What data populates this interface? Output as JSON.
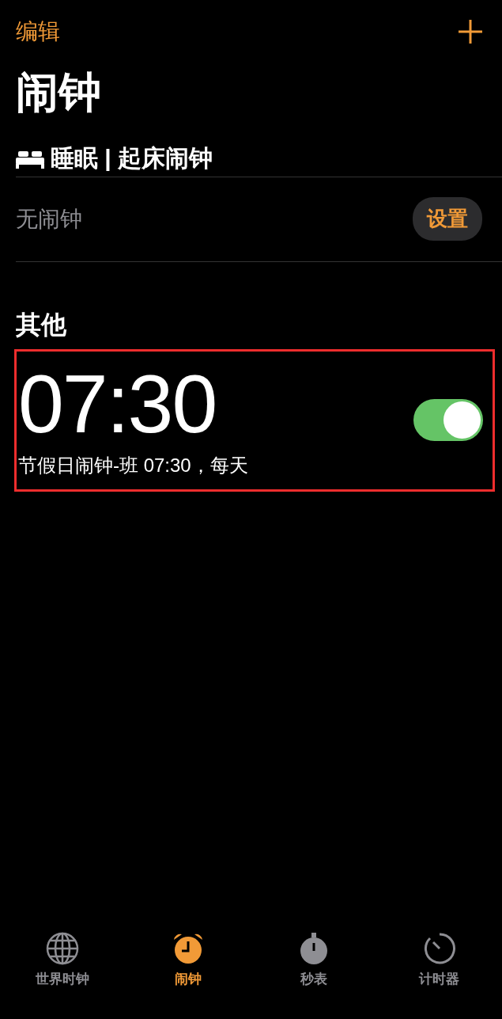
{
  "nav": {
    "edit": "编辑"
  },
  "title": "闹钟",
  "sleep": {
    "title": "睡眠 | 起床闹钟",
    "empty": "无闹钟",
    "button": "设置"
  },
  "other": {
    "heading": "其他",
    "alarms": [
      {
        "time": "07:30",
        "label": "节假日闹钟-班 07:30，每天",
        "on": true,
        "highlighted": true
      }
    ]
  },
  "tabs": [
    {
      "kind": "globe",
      "label": "世界时钟",
      "selected": false
    },
    {
      "kind": "alarm",
      "label": "闹钟",
      "selected": true
    },
    {
      "kind": "stopwatch",
      "label": "秒表",
      "selected": false
    },
    {
      "kind": "timer",
      "label": "计时器",
      "selected": false
    }
  ]
}
